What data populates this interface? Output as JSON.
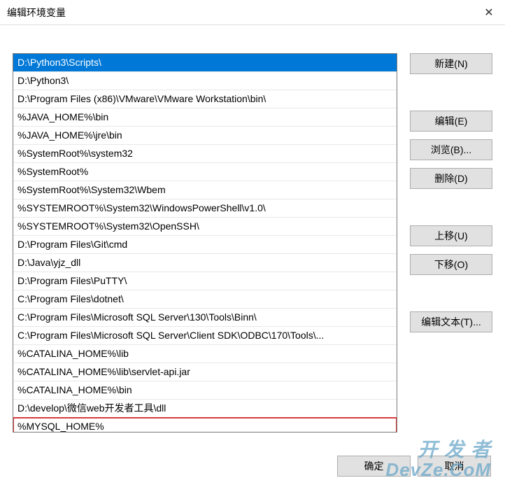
{
  "dialog": {
    "title": "编辑环境变量"
  },
  "list": {
    "items": [
      {
        "text": "D:\\Python3\\Scripts\\",
        "selected": true
      },
      {
        "text": "D:\\Python3\\"
      },
      {
        "text": "D:\\Program Files (x86)\\VMware\\VMware Workstation\\bin\\"
      },
      {
        "text": "%JAVA_HOME%\\bin"
      },
      {
        "text": "%JAVA_HOME%\\jre\\bin"
      },
      {
        "text": "%SystemRoot%\\system32"
      },
      {
        "text": "%SystemRoot%"
      },
      {
        "text": "%SystemRoot%\\System32\\Wbem"
      },
      {
        "text": "%SYSTEMROOT%\\System32\\WindowsPowerShell\\v1.0\\"
      },
      {
        "text": "%SYSTEMROOT%\\System32\\OpenSSH\\"
      },
      {
        "text": "D:\\Program Files\\Git\\cmd"
      },
      {
        "text": "D:\\Java\\yjz_dll"
      },
      {
        "text": "D:\\Program Files\\PuTTY\\"
      },
      {
        "text": "C:\\Program Files\\dotnet\\"
      },
      {
        "text": "C:\\Program Files\\Microsoft SQL Server\\130\\Tools\\Binn\\"
      },
      {
        "text": "C:\\Program Files\\Microsoft SQL Server\\Client SDK\\ODBC\\170\\Tools\\..."
      },
      {
        "text": "%CATALINA_HOME%\\lib"
      },
      {
        "text": "%CATALINA_HOME%\\lib\\servlet-api.jar"
      },
      {
        "text": "%CATALINA_HOME%\\bin"
      },
      {
        "text": "D:\\develop\\微信web开发者工具\\dll"
      },
      {
        "text": "%MYSQL_HOME%",
        "highlighted": true
      }
    ]
  },
  "buttons": {
    "new": "新建(N)",
    "edit": "编辑(E)",
    "browse": "浏览(B)...",
    "delete": "删除(D)",
    "moveUp": "上移(U)",
    "moveDown": "下移(O)",
    "editText": "编辑文本(T)...",
    "ok": "确定",
    "cancel": "取消"
  },
  "watermark": {
    "line1": "开 发 者",
    "line2": "DevZe.CoM"
  }
}
